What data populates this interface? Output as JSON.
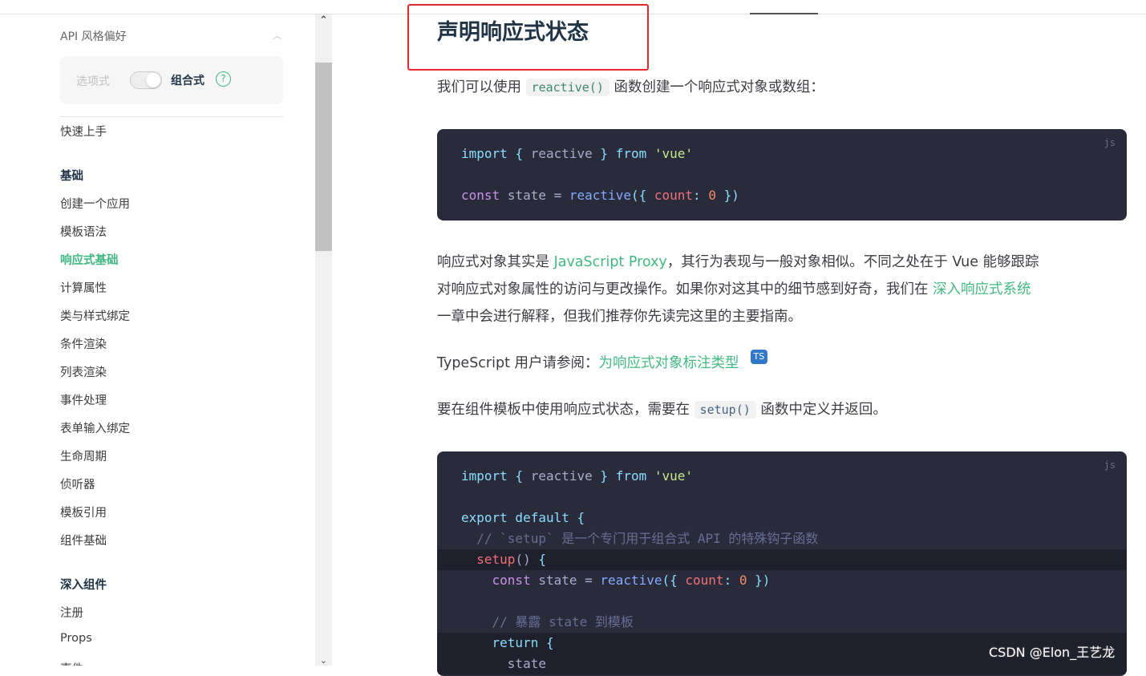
{
  "sidebar": {
    "api_title": "API 风格偏好",
    "options_label": "选项式",
    "composition_label": "组合式",
    "help": "?",
    "toggle_state": "composition",
    "items": [
      {
        "label": "快速上手",
        "type": "link"
      },
      {
        "label": "基础",
        "type": "heading"
      },
      {
        "label": "创建一个应用",
        "type": "link"
      },
      {
        "label": "模板语法",
        "type": "link"
      },
      {
        "label": "响应式基础",
        "type": "active"
      },
      {
        "label": "计算属性",
        "type": "link"
      },
      {
        "label": "类与样式绑定",
        "type": "link"
      },
      {
        "label": "条件渲染",
        "type": "link"
      },
      {
        "label": "列表渲染",
        "type": "link"
      },
      {
        "label": "事件处理",
        "type": "link"
      },
      {
        "label": "表单输入绑定",
        "type": "link"
      },
      {
        "label": "生命周期",
        "type": "link"
      },
      {
        "label": "侦听器",
        "type": "link"
      },
      {
        "label": "模板引用",
        "type": "link"
      },
      {
        "label": "组件基础",
        "type": "link"
      },
      {
        "label": "深入组件",
        "type": "heading"
      },
      {
        "label": "注册",
        "type": "link"
      },
      {
        "label": "Props",
        "type": "link"
      },
      {
        "label": "事件",
        "type": "link"
      }
    ]
  },
  "main": {
    "title": "声明响应式状态",
    "p1_a": "我们可以使用 ",
    "p1_code": "reactive()",
    "p1_b": " 函数创建一个响应式对象或数组：",
    "code_lang": "js",
    "p2_a": "响应式对象其实是 ",
    "p2_link": "JavaScript Proxy",
    "p2_b": "，其行为表现与一般对象相似。不同之处在于 Vue 能够跟踪",
    "p2_c": "对响应式对象属性的访问与更改操作。如果你对这其中的细节感到好奇，我们在 ",
    "p2_link2": "深入响应式系统",
    "p2_d": "一章中会进行解释，但我们推荐你先读完这里的主要指南。",
    "p3_a": "TypeScript 用户请参阅：",
    "p3_link": "为响应式对象标注类型",
    "ts_badge": "TS",
    "p4_a": "要在组件模板中使用响应式状态，需要在 ",
    "p4_code": "setup()",
    "p4_b": " 函数中定义并返回。",
    "c1": {
      "import": "import",
      "lb": "{",
      "reactive": "reactive",
      "rb": "}",
      "from": "from",
      "vue": "'vue'",
      "const": "const",
      "state": "state =",
      "fn": "reactive",
      "open": "({",
      "count": "count",
      "colon": ":",
      "zero": "0",
      "close": "})"
    },
    "c2": {
      "export": "export default",
      "lb": "{",
      "comment1": "// `setup` 是一个专门用于组合式 API 的特殊钩子函数",
      "setup": "setup",
      "paren": "()",
      "comment2": "// 暴露 state 到模板",
      "return": "return",
      "state": "state"
    }
  },
  "watermark": "CSDN @Elon_王艺龙",
  "colors": {
    "accent": "#42b883",
    "code_bg": "#292b3b",
    "highlight_box": "#e8282b"
  }
}
